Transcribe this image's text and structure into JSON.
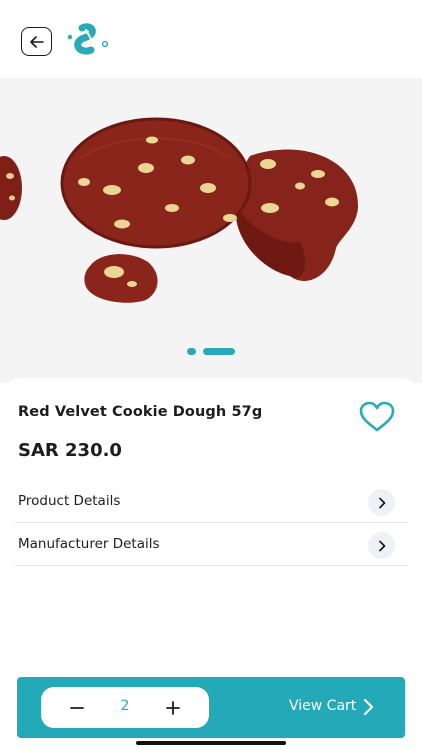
{
  "header": {
    "back_icon": "arrow-left-icon",
    "logo_icon": "brand-logo-icon"
  },
  "gallery": {
    "image": "red-velvet-cookie-photo",
    "pages": 2,
    "active_page": 2
  },
  "product": {
    "title": "Red Velvet Cookie Dough 57g",
    "price": "SAR 230.0",
    "favorite_icon": "heart-outline-icon"
  },
  "details": [
    {
      "label": "Product Details",
      "icon": "chevron-right-icon"
    },
    {
      "label": "Manufacturer Details",
      "icon": "chevron-right-icon"
    }
  ],
  "cart": {
    "quantity": "2",
    "view_cart_label": "View Cart",
    "minus_icon": "minus-icon",
    "plus_icon": "plus-icon",
    "arrow_icon": "chevron-right-icon"
  },
  "colors": {
    "accent": "#23a9b7",
    "text": "#1d1d1f",
    "chevron_bg": "#eef2f6"
  }
}
